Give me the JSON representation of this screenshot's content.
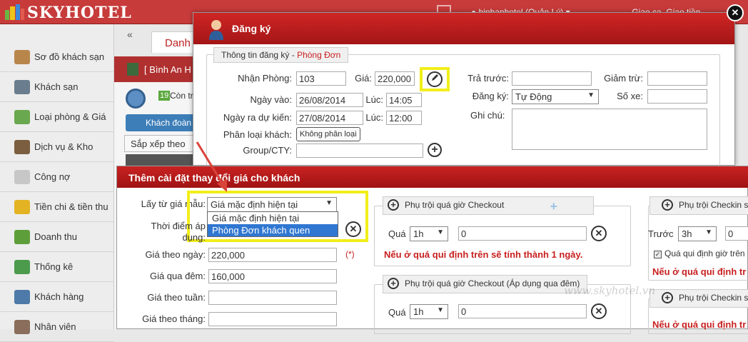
{
  "app": {
    "logo": "SKYHOTEL",
    "user": "binhanhotel (Quản Lý)",
    "shift": "Giao ca, Giao tiền"
  },
  "sidebar": {
    "collapse": "«",
    "items": [
      {
        "label": "Sơ đồ khách sạn",
        "icon": "hotel-map-icon"
      },
      {
        "label": "Khách sạn",
        "icon": "building-icon"
      },
      {
        "label": "Loại phòng & Giá",
        "icon": "room-type-icon"
      },
      {
        "label": "Dịch vụ & Kho",
        "icon": "service-icon"
      },
      {
        "label": "Công nợ",
        "icon": "debt-icon"
      },
      {
        "label": "Tiền chi & tiền thu",
        "icon": "money-icon"
      },
      {
        "label": "Doanh thu",
        "icon": "revenue-icon"
      },
      {
        "label": "Thống kê",
        "icon": "stats-icon"
      },
      {
        "label": "Khách hàng",
        "icon": "customer-icon"
      },
      {
        "label": "Nhân viên",
        "icon": "staff-icon"
      }
    ]
  },
  "background": {
    "tab": "Danh",
    "panel_title": "[ Bình An H",
    "count": "19",
    "count_label": "Còn tr",
    "button_guest": "Khách đoàn",
    "button_sort": "Sắp xếp theo"
  },
  "register": {
    "title": "Đăng ký",
    "legend_prefix": "Thông tin đăng ký - ",
    "legend_room": "Phòng Đơn",
    "checkin_room_label": "Nhận Phòng:",
    "checkin_room": "103",
    "price_label": "Giá:",
    "price": "220,000",
    "date_in_label": "Ngày vào:",
    "date_in": "26/08/2014",
    "time_label": "Lúc:",
    "time_in": "14:05",
    "date_out_label": "Ngày ra dự kiến:",
    "date_out": "27/08/2014",
    "time_out": "12:00",
    "guest_type_label": "Phân loại khách:",
    "guest_type_btn": "Không phân loại",
    "group_label": "Group/CTY:",
    "group": "",
    "prepay_label": "Trả trước:",
    "prepay": "",
    "register_label": "Đăng ký:",
    "register_value": "Tự Động",
    "discount_label": "Giảm trừ:",
    "discount": "",
    "plate_label": "Số xe:",
    "plate": "",
    "note_label": "Ghi chú:",
    "note": ""
  },
  "price_change": {
    "title": "Thêm cài đặt thay đổi giá cho khách",
    "template_label": "Lấy từ giá mẫu:",
    "template_selected": "Giá mặc định hiện tại",
    "template_options": [
      "Giá mặc định hiện tại",
      "Phòng Đơn khách quen"
    ],
    "apply_time_label_1": "Thời điểm áp",
    "apply_time_label_2": "dụng:",
    "daily_label": "Giá theo ngày:",
    "daily": "220,000",
    "required": "(*)",
    "overnight_label": "Giá qua đêm:",
    "overnight": "160,000",
    "weekly_label": "Giá theo tuần:",
    "weekly": "",
    "monthly_label": "Giá theo tháng:",
    "monthly": "",
    "checkout_title": "Phụ trội quá giờ Checkout",
    "over_label": "Quá",
    "over_value": "1h",
    "over_amount": "0",
    "checkout_note": "Nếu ở quá qui định trên sẽ tính thành 1 ngày.",
    "checkout_overnight_title": "Phụ trội quá giờ Checkout (Áp dụng qua đêm)",
    "over2_value": "1h",
    "over2_amount": "0",
    "checkin_title": "Phụ trội Checkin s",
    "before_label": "Trước",
    "before_value": "3h",
    "before_amount": "0",
    "checkin_chk": "Quá qui định giờ trên",
    "checkin_note": "Nếu ở quá qui định tr",
    "checkin2_title": "Phụ trội Checkin s",
    "checkin2_note": "Nếu ở quá qui định tr"
  },
  "watermark": "www.skyhotel.vn",
  "colors": {
    "brand": "#c73b3b",
    "highlight": "#f2ee1a",
    "arrow": "#d9443a"
  }
}
